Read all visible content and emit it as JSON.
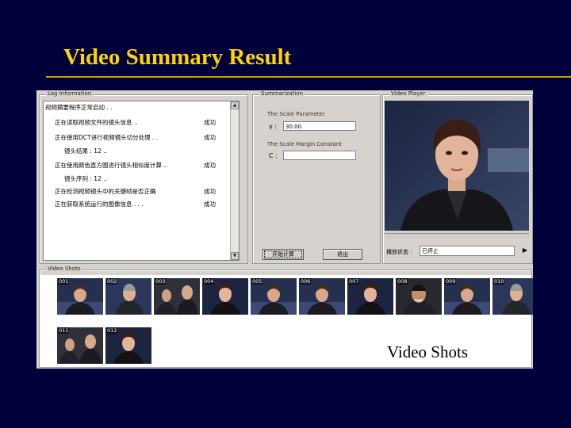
{
  "slide": {
    "title": "Video Summary Result",
    "caption": "Video Shots"
  },
  "window": {
    "log_panel": {
      "title": "Log Information",
      "rows": [
        {
          "msg": "视频摘要程序正常启动 . .",
          "status": ""
        },
        {
          "msg": "正在读取视频文件的镜头信息 ..",
          "status": "成功"
        },
        {
          "msg": "正在使用DCT进行视频镜头切分处理 . .",
          "status": "成功"
        },
        {
          "msg": "镜头结果 : 12 ..",
          "status": ""
        },
        {
          "msg": "正在使用颜色直方图进行镜头相似度计算 ..",
          "status": "成功"
        },
        {
          "msg": "镜头序列 : 12 ..",
          "status": ""
        },
        {
          "msg": "正在检测视频镜头中的关键帧是否正确",
          "status": "成功"
        },
        {
          "msg": "正在获取系统运行的图像信息 . . .",
          "status": "成功"
        }
      ]
    },
    "summ_panel": {
      "title": "Summarization",
      "param1_label": "The Scale Parameter",
      "param1_key": "γ :",
      "param1_value": "30.00",
      "param2_label": "The Scale Margin Constant",
      "param2_key": "C :",
      "param2_value": "",
      "start_label": "开始计算",
      "quit_label": "退出"
    },
    "player_panel": {
      "title": "Video Player",
      "status_label": "播放状态 :",
      "status_value": "已停止",
      "play_glyph": "▶"
    },
    "shots_panel": {
      "title": "Video Shots",
      "shots": [
        {
          "num": "001"
        },
        {
          "num": "002"
        },
        {
          "num": "003"
        },
        {
          "num": "004"
        },
        {
          "num": "005"
        },
        {
          "num": "006"
        },
        {
          "num": "007"
        },
        {
          "num": "008"
        },
        {
          "num": "009"
        },
        {
          "num": "010"
        },
        {
          "num": "011"
        },
        {
          "num": "012"
        }
      ]
    }
  },
  "colors": {
    "slide_bg": "#00003a",
    "title": "#ffd400",
    "window_bg": "#d6d3ce"
  }
}
